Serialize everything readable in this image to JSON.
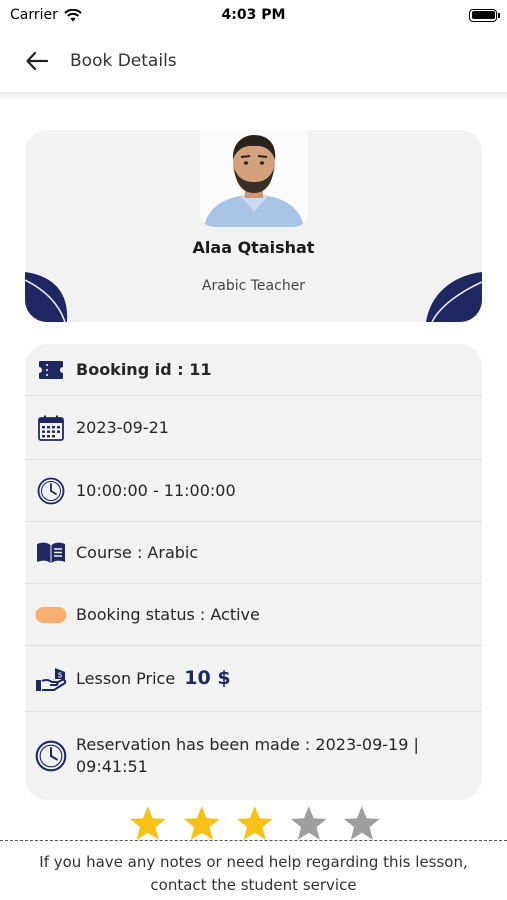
{
  "status_bar": {
    "carrier": "Carrier",
    "time": "4:03 PM"
  },
  "app_bar": {
    "title": "Book Details"
  },
  "teacher": {
    "name": "Alaa Qtaishat",
    "role": "Arabic Teacher"
  },
  "booking": {
    "id_label": "Booking id :",
    "id_value": "11",
    "date": "2023-09-21",
    "time_range": "10:00:00 - 11:00:00",
    "course": "Course : Arabic",
    "status": "Booking status : Active",
    "status_color": "#f7ae6e",
    "price_label": "Lesson Price",
    "price_value": "10 $",
    "reservation_line1": "Reservation has been made :  2023-09-19 |",
    "reservation_line2": "09:41:51"
  },
  "rating": {
    "value": 3,
    "max": 5,
    "filled_color": "#f9c015",
    "empty_color": "#9e9e9e"
  },
  "footer": {
    "line1": "If you have any notes or need help regarding this lesson,",
    "line2": "contact the student service"
  },
  "colors": {
    "accent": "#1e2761",
    "card_bg": "#f2f2f2"
  },
  "icons": [
    "back-arrow-icon",
    "wifi-icon",
    "battery-icon",
    "ticket-icon",
    "calendar-icon",
    "clock-icon",
    "book-icon",
    "status-pill-icon",
    "price-hand-icon",
    "star-icon"
  ]
}
